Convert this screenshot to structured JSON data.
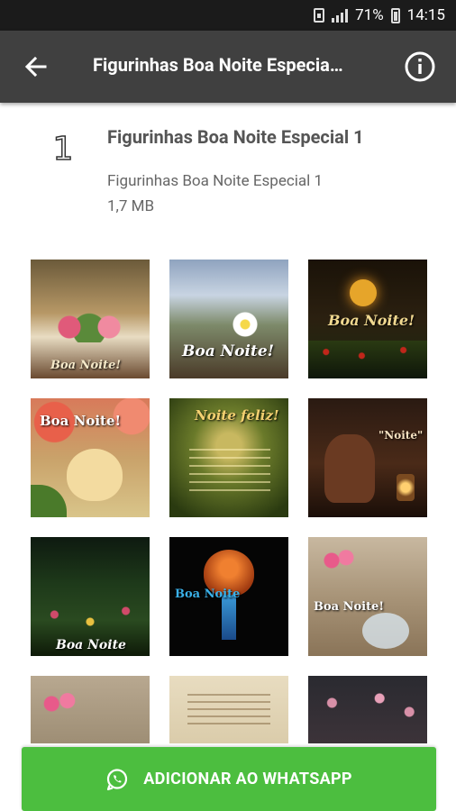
{
  "status_bar": {
    "battery": "71%",
    "time": "14:15"
  },
  "app_bar": {
    "title": "Figurinhas Boa Noite Especia…"
  },
  "pack": {
    "number_icon": "1",
    "name": "Figurinhas Boa Noite Especial 1",
    "subtitle": "Figurinhas Boa Noite Especial 1",
    "size": "1,7 MB"
  },
  "stickers": [
    {
      "caption": "Boa Noite!"
    },
    {
      "caption": "Boa Noite!"
    },
    {
      "caption": "Boa Noite!"
    },
    {
      "caption": "Boa Noite!"
    },
    {
      "caption": "Noite feliz!"
    },
    {
      "caption": "\"Noite\""
    },
    {
      "caption": "Boa Noite"
    },
    {
      "caption": "Boa Noite"
    },
    {
      "caption": "Boa Noite!"
    }
  ],
  "add_button": {
    "label": "ADICIONAR AO WHATSAPP"
  },
  "colors": {
    "status_bar": "#1b1b1b",
    "app_bar": "#404040",
    "add_button": "#4cbe3f"
  }
}
